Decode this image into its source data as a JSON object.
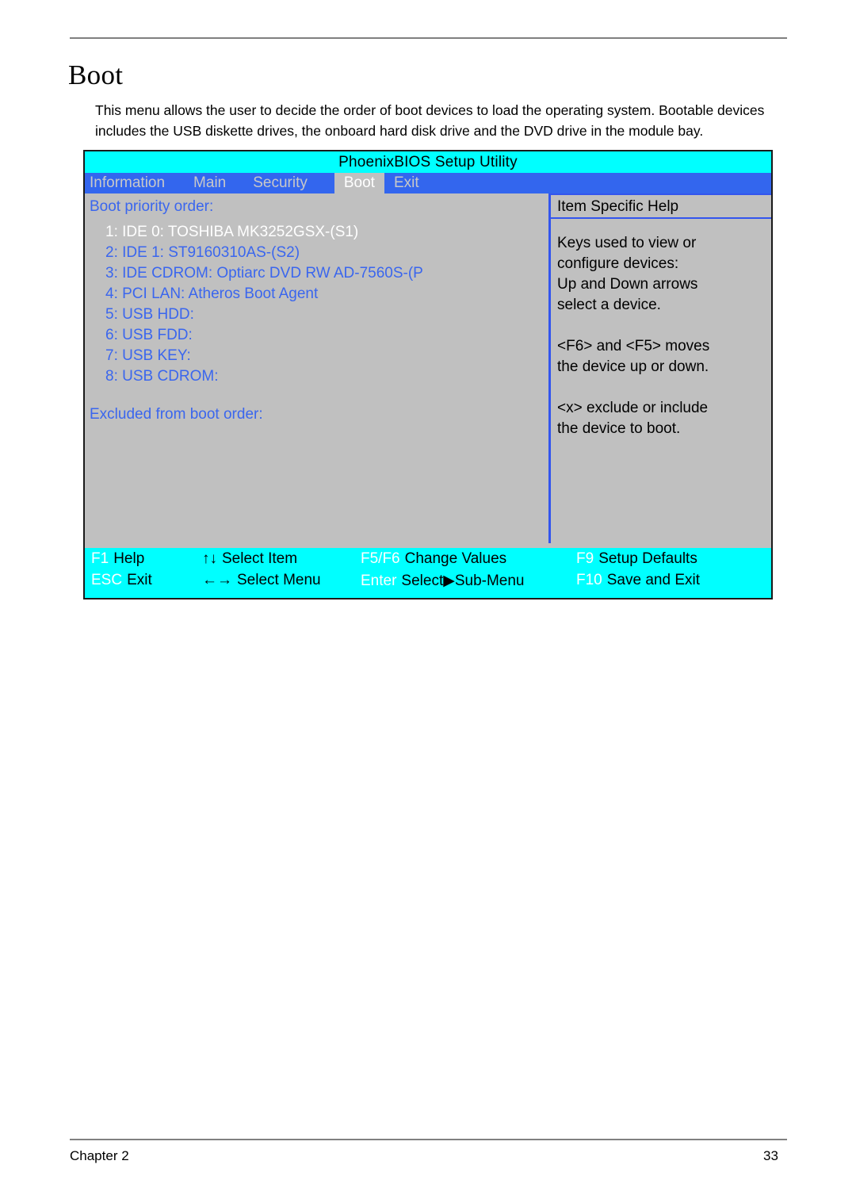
{
  "document": {
    "heading": "Boot",
    "intro": "This menu allows the user to decide the order of boot devices to load the operating system. Bootable devices includes the USB diskette drives, the onboard hard disk drive and the DVD drive in the module bay.",
    "footer_left": "Chapter 2",
    "footer_right": "33"
  },
  "bios": {
    "title": "PhoenixBIOS Setup Utility",
    "tabs": [
      {
        "label": "Information",
        "active": false
      },
      {
        "label": "Main",
        "active": false
      },
      {
        "label": "Security",
        "active": false
      },
      {
        "label": "Boot",
        "active": true
      },
      {
        "label": "Exit",
        "active": false
      }
    ],
    "boot_priority_label": "Boot priority order:",
    "boot_items": [
      {
        "text": "1: IDE 0: TOSHIBA MK3252GSX-(S1)",
        "selected": true
      },
      {
        "text": "2: IDE 1: ST9160310AS-(S2)",
        "selected": false
      },
      {
        "text": "3: IDE CDROM: Optiarc DVD RW AD-7560S-(P",
        "selected": false
      },
      {
        "text": "4: PCI LAN: Atheros Boot Agent",
        "selected": false
      },
      {
        "text": "5: USB HDD:",
        "selected": false
      },
      {
        "text": "6: USB FDD:",
        "selected": false
      },
      {
        "text": "7: USB KEY:",
        "selected": false
      },
      {
        "text": "8: USB CDROM:",
        "selected": false
      }
    ],
    "excluded_label": "Excluded from boot order:",
    "help": {
      "title": "Item Specific Help",
      "paragraphs": [
        "Keys used to view or\nconfigure devices:\nUp and Down arrows\nselect a device.",
        "<F6> and <F5> moves\nthe device up or down.",
        "<x> exclude or include\nthe device to boot."
      ]
    },
    "keys": [
      {
        "name": "F1",
        "desc": "Help"
      },
      {
        "name": "↑↓",
        "desc": "Select Item"
      },
      {
        "name": "F5/F6",
        "desc": "Change Values"
      },
      {
        "name": "F9",
        "desc": "Setup Defaults"
      },
      {
        "name": "ESC",
        "desc": "Exit"
      },
      {
        "name": "←→",
        "desc": "Select Menu"
      },
      {
        "name": "Enter",
        "desc": "Select▶Sub-Menu"
      },
      {
        "name": "F10",
        "desc": "Save and Exit"
      }
    ],
    "colors": {
      "title_bg": "#00ffff",
      "tab_bg": "#3366ee",
      "panel_bg": "#c0c0c0",
      "text_blue": "#3a66ee",
      "selected_text": "#ffffff",
      "keybar_bg": "#00ffff"
    }
  }
}
